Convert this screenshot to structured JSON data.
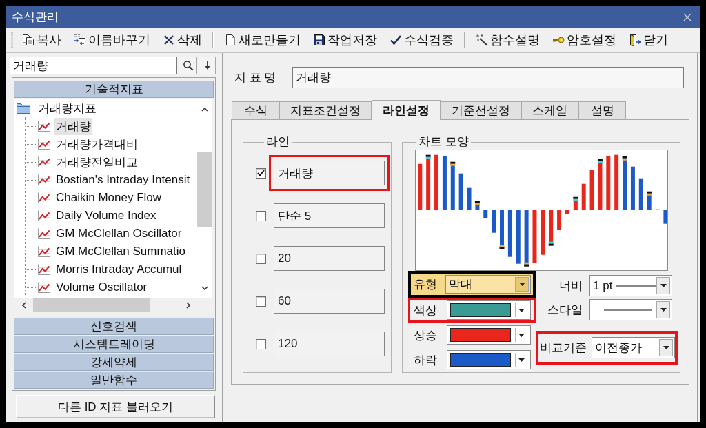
{
  "window": {
    "title": "수식관리"
  },
  "toolbar": {
    "groups": [
      [
        {
          "label": "복사"
        },
        {
          "label": "이름바꾸기"
        },
        {
          "label": "삭제"
        }
      ],
      [
        {
          "label": "새로만들기"
        },
        {
          "label": "작업저장"
        },
        {
          "label": "수식검증"
        }
      ],
      [
        {
          "label": "함수설명"
        },
        {
          "label": "암호설정"
        },
        {
          "label": "닫기"
        }
      ]
    ]
  },
  "sidebar": {
    "search": {
      "value": "거래량"
    },
    "sections": [
      {
        "label": "기술적지표",
        "tree": [
          {
            "label": "거래량지표",
            "children": [
              {
                "label": "거래량",
                "selected": true
              },
              {
                "label": "거래량가격대비",
                "selected": false
              },
              {
                "label": "거래량전일비교",
                "selected": false
              },
              {
                "label": "Bostian's Intraday Intensit",
                "selected": false
              },
              {
                "label": "Chaikin Money Flow",
                "selected": false
              },
              {
                "label": "Daily Volume Index",
                "selected": false
              },
              {
                "label": "GM McClellan Oscillator",
                "selected": false
              },
              {
                "label": "GM McClellan Summatio",
                "selected": false
              },
              {
                "label": "Morris Intraday Accumul",
                "selected": false
              },
              {
                "label": "Volume Oscillator",
                "selected": false
              }
            ]
          }
        ]
      },
      {
        "label": "신호검색"
      },
      {
        "label": "시스템트레이딩"
      },
      {
        "label": "강세약세"
      },
      {
        "label": "일반함수"
      }
    ],
    "load_button": "다른 ID 지표 불러오기"
  },
  "indicator_name": {
    "label": "지 표 명",
    "value": "거래량"
  },
  "tabs": [
    {
      "label": "수식",
      "selected": false
    },
    {
      "label": "지표조건설정",
      "selected": false
    },
    {
      "label": "라인설정",
      "selected": true
    },
    {
      "label": "기준선설정",
      "selected": false
    },
    {
      "label": "스케일",
      "selected": false
    },
    {
      "label": "설명",
      "selected": false
    }
  ],
  "line_settings": {
    "title": "라인",
    "lines": [
      {
        "checked": true,
        "value": "거래량",
        "highlight": {
          "color": "#e8141c"
        }
      },
      {
        "checked": false,
        "value": "단순 5"
      },
      {
        "checked": false,
        "value": "20"
      },
      {
        "checked": false,
        "value": "60"
      },
      {
        "checked": false,
        "value": "120"
      }
    ]
  },
  "chart_shape": {
    "title": "차트 모양",
    "type": {
      "label": "유형",
      "value": "막대",
      "focused": true,
      "highlight": {
        "color": "#000000"
      }
    },
    "colors": [
      {
        "label": "색상",
        "color": "#3a9a94",
        "highlight": {
          "color": "#e8141c"
        }
      },
      {
        "label": "상승",
        "color": "#e8261b"
      },
      {
        "label": "하락",
        "color": "#1c5ac8"
      }
    ],
    "width": {
      "label": "너비",
      "value": "1 pt"
    },
    "style": {
      "label": "스타일"
    },
    "compare": {
      "label": "비교기준",
      "value": "이전종가",
      "highlight": {
        "color": "#e8141c"
      }
    }
  }
}
